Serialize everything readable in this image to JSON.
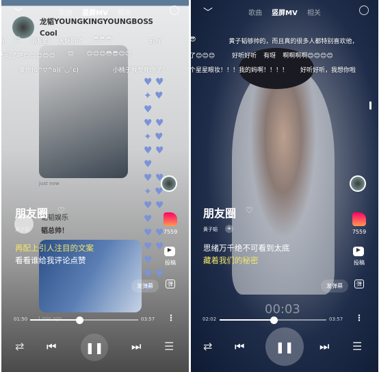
{
  "tabs": [
    "歌曲",
    "竖屏MV",
    "相关"
  ],
  "left": {
    "user_name": "龙韬YOUNGKINGYOUNGBOSS",
    "user_comment": "Cool",
    "danmaku": [
      [
        "听",
        "😊",
        "朋友圈",
        "太好听了",
        "😎😎😎",
        "前方"
      ],
      [
        "太可了吧😊😊😊😊😊",
        "😊",
        "😊😊😊😳😎😊😊"
      ],
      [
        "爱你(o^▽^o)(ˊ◡ˋc)",
        "小桃子我觉死你了！",
        "Ra"
      ]
    ],
    "post_time": "Just now",
    "post_source": "韬韬娱乐",
    "post_text": "韬总帅！",
    "song_title": "朋友圈",
    "artist": "黄子韬",
    "lyric_1": "再配上引人注目的文案",
    "lyric_2": "看看谁给我评论点赞",
    "like_count": "7559",
    "upload_label": "投稿",
    "danmaku_button": "发弹幕",
    "danmaku_toggle": "弹",
    "overlay_time": "1 min ago",
    "elapsed": "01:50",
    "duration": "03:57",
    "progress": 0.46
  },
  "right": {
    "danmaku": [
      [
        "😎",
        "黄子韬够帅的，而且真的很多人都特别喜欢他，"
      ],
      [
        "了😊😊😊",
        "好听好听",
        "有呀",
        "啊啊啊啊😊😊😊😊"
      ],
      [
        "个星星眼妆！！！我的妈啊！！！！",
        "好听好听，我想你啦"
      ]
    ],
    "song_title": "朋友圈",
    "artist": "黄子韬",
    "lyric_1": "思绪万千绝不可看到太底",
    "lyric_2": "藏着我们的秘密",
    "like_count": "7559",
    "upload_label": "投稿",
    "danmaku_button": "发弹幕",
    "danmaku_toggle": "弹",
    "center_time": "00:03",
    "elapsed": "02:02",
    "duration": "03:57",
    "progress": 0.51
  },
  "colors": {
    "lyric_highlight": "#f1e46a",
    "like": "#ff3d7f"
  }
}
